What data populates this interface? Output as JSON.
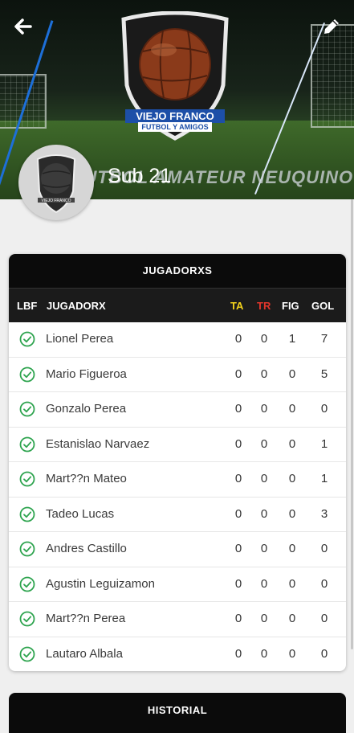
{
  "header": {
    "team_name": "Sub 21",
    "logo_title": "VIEJO FRANCO",
    "logo_subtitle": "FUTBOL Y AMIGOS",
    "banner_text": "FUTBOL AMATEUR NEUQUINO",
    "avatar_title": "VIEJO FRANCO"
  },
  "players_card": {
    "title": "JUGADORXS",
    "columns": {
      "lbf": "LBF",
      "player": "JUGADORX",
      "ta": "TA",
      "tr": "TR",
      "fig": "FIG",
      "gol": "GOL"
    },
    "column_colors": {
      "ta": "#f2d21b",
      "tr": "#e0352b"
    },
    "rows": [
      {
        "name": "Lionel Perea",
        "ta": "0",
        "tr": "0",
        "fig": "1",
        "gol": "7"
      },
      {
        "name": "Mario Figueroa",
        "ta": "0",
        "tr": "0",
        "fig": "0",
        "gol": "5"
      },
      {
        "name": "Gonzalo Perea",
        "ta": "0",
        "tr": "0",
        "fig": "0",
        "gol": "0"
      },
      {
        "name": "Estanislao Narvaez",
        "ta": "0",
        "tr": "0",
        "fig": "0",
        "gol": "1"
      },
      {
        "name": "Mart??n Mateo",
        "ta": "0",
        "tr": "0",
        "fig": "0",
        "gol": "1"
      },
      {
        "name": "Tadeo Lucas",
        "ta": "0",
        "tr": "0",
        "fig": "0",
        "gol": "3"
      },
      {
        "name": "Andres Castillo",
        "ta": "0",
        "tr": "0",
        "fig": "0",
        "gol": "0"
      },
      {
        "name": "Agustin Leguizamon",
        "ta": "0",
        "tr": "0",
        "fig": "0",
        "gol": "0"
      },
      {
        "name": "Mart??n Perea",
        "ta": "0",
        "tr": "0",
        "fig": "0",
        "gol": "0"
      },
      {
        "name": "Lautaro Albala",
        "ta": "0",
        "tr": "0",
        "fig": "0",
        "gol": "0"
      }
    ]
  },
  "history_card": {
    "title": "HISTORIAL"
  },
  "icons": {
    "back": "arrow-left-icon",
    "edit": "pencil-icon",
    "check": "check-circle-icon"
  },
  "colors": {
    "check": "#2ea44f",
    "header_bg": "#0b0b0b",
    "logo_blue": "#1d4fa8"
  }
}
